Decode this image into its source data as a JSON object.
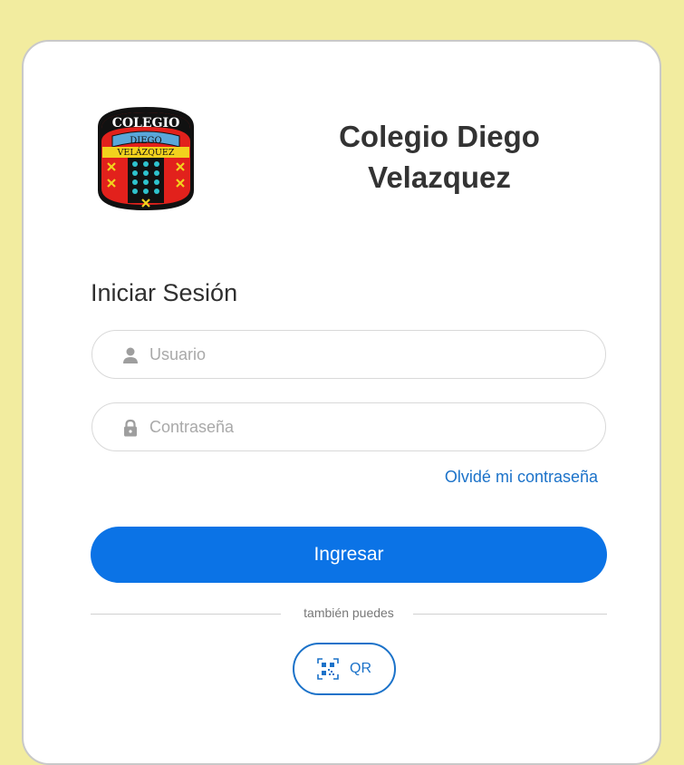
{
  "school": {
    "name_line1": "Colegio Diego",
    "name_line2": "Velazquez",
    "logo_text_top": "COLEGIO",
    "logo_text_mid": "DIEGO",
    "logo_text_bottom": "VELÁZQUEZ"
  },
  "login": {
    "title": "Iniciar Sesión",
    "username_placeholder": "Usuario",
    "password_placeholder": "Contraseña",
    "forgot_link": "Olvidé mi contraseña",
    "submit_label": "Ingresar",
    "divider_text": "también puedes",
    "qr_label": "QR"
  },
  "icons": {
    "username": "user-icon",
    "password": "lock-icon",
    "qr": "qr-code-icon"
  },
  "colors": {
    "background": "#f2ec9f",
    "primary": "#0b73e6",
    "link": "#1b72c9",
    "text_dark": "#333333"
  }
}
